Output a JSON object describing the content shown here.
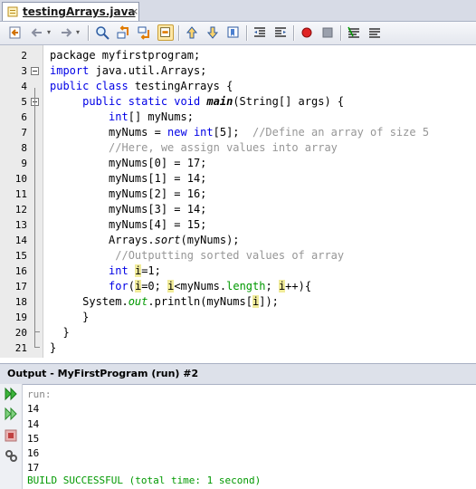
{
  "tab": {
    "title": "testingArrays.java",
    "close": "×"
  },
  "editor": {
    "line_numbers": [
      "2",
      "3",
      "4",
      "5",
      "6",
      "7",
      "8",
      "9",
      "10",
      "11",
      "12",
      "13",
      "14",
      "15",
      "16",
      "17",
      "18",
      "19",
      "20",
      "21"
    ]
  },
  "output": {
    "title": "Output - MyFirstProgram (run) #2",
    "lines": [
      "run:",
      "14",
      "14",
      "15",
      "16",
      "17",
      "BUILD SUCCESSFUL (total time: 1 second)"
    ]
  },
  "colors": {
    "keyword": "#0000e6",
    "comment": "#969696",
    "field": "#009900",
    "highlight": "#f0eb9a"
  }
}
